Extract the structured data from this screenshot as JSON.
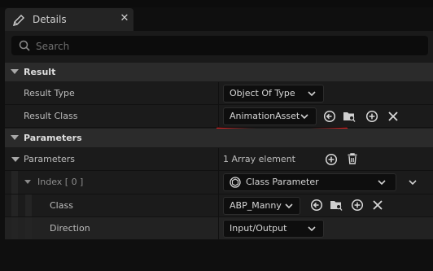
{
  "tab": {
    "title": "Details",
    "close_glyph": "✕"
  },
  "search": {
    "placeholder": "Search"
  },
  "sections": {
    "result": "Result",
    "parameters": "Parameters"
  },
  "result": {
    "type_label": "Result Type",
    "type_value": "Object Of Type",
    "class_label": "Result Class",
    "class_value": "AnimationAsset"
  },
  "parameters": {
    "label": "Parameters",
    "count": "1 Array element",
    "index_label": "Index [ 0 ]",
    "index_value": "Class Parameter",
    "class_label": "Class",
    "class_value": "ABP_Manny",
    "direction_label": "Direction",
    "direction_value": "Input/Output"
  },
  "icons": {
    "tab": "pencil-icon",
    "search": "search-icon",
    "browse_back": "use-selected-icon",
    "browse_folder": "browse-folder-icon",
    "add": "add-icon",
    "clear": "clear-icon",
    "delete": "trash-icon"
  },
  "colors": {
    "annotation_underline": "#d62020",
    "panel_bg": "#1a1a1a",
    "section_bg": "#2b2b2b"
  }
}
